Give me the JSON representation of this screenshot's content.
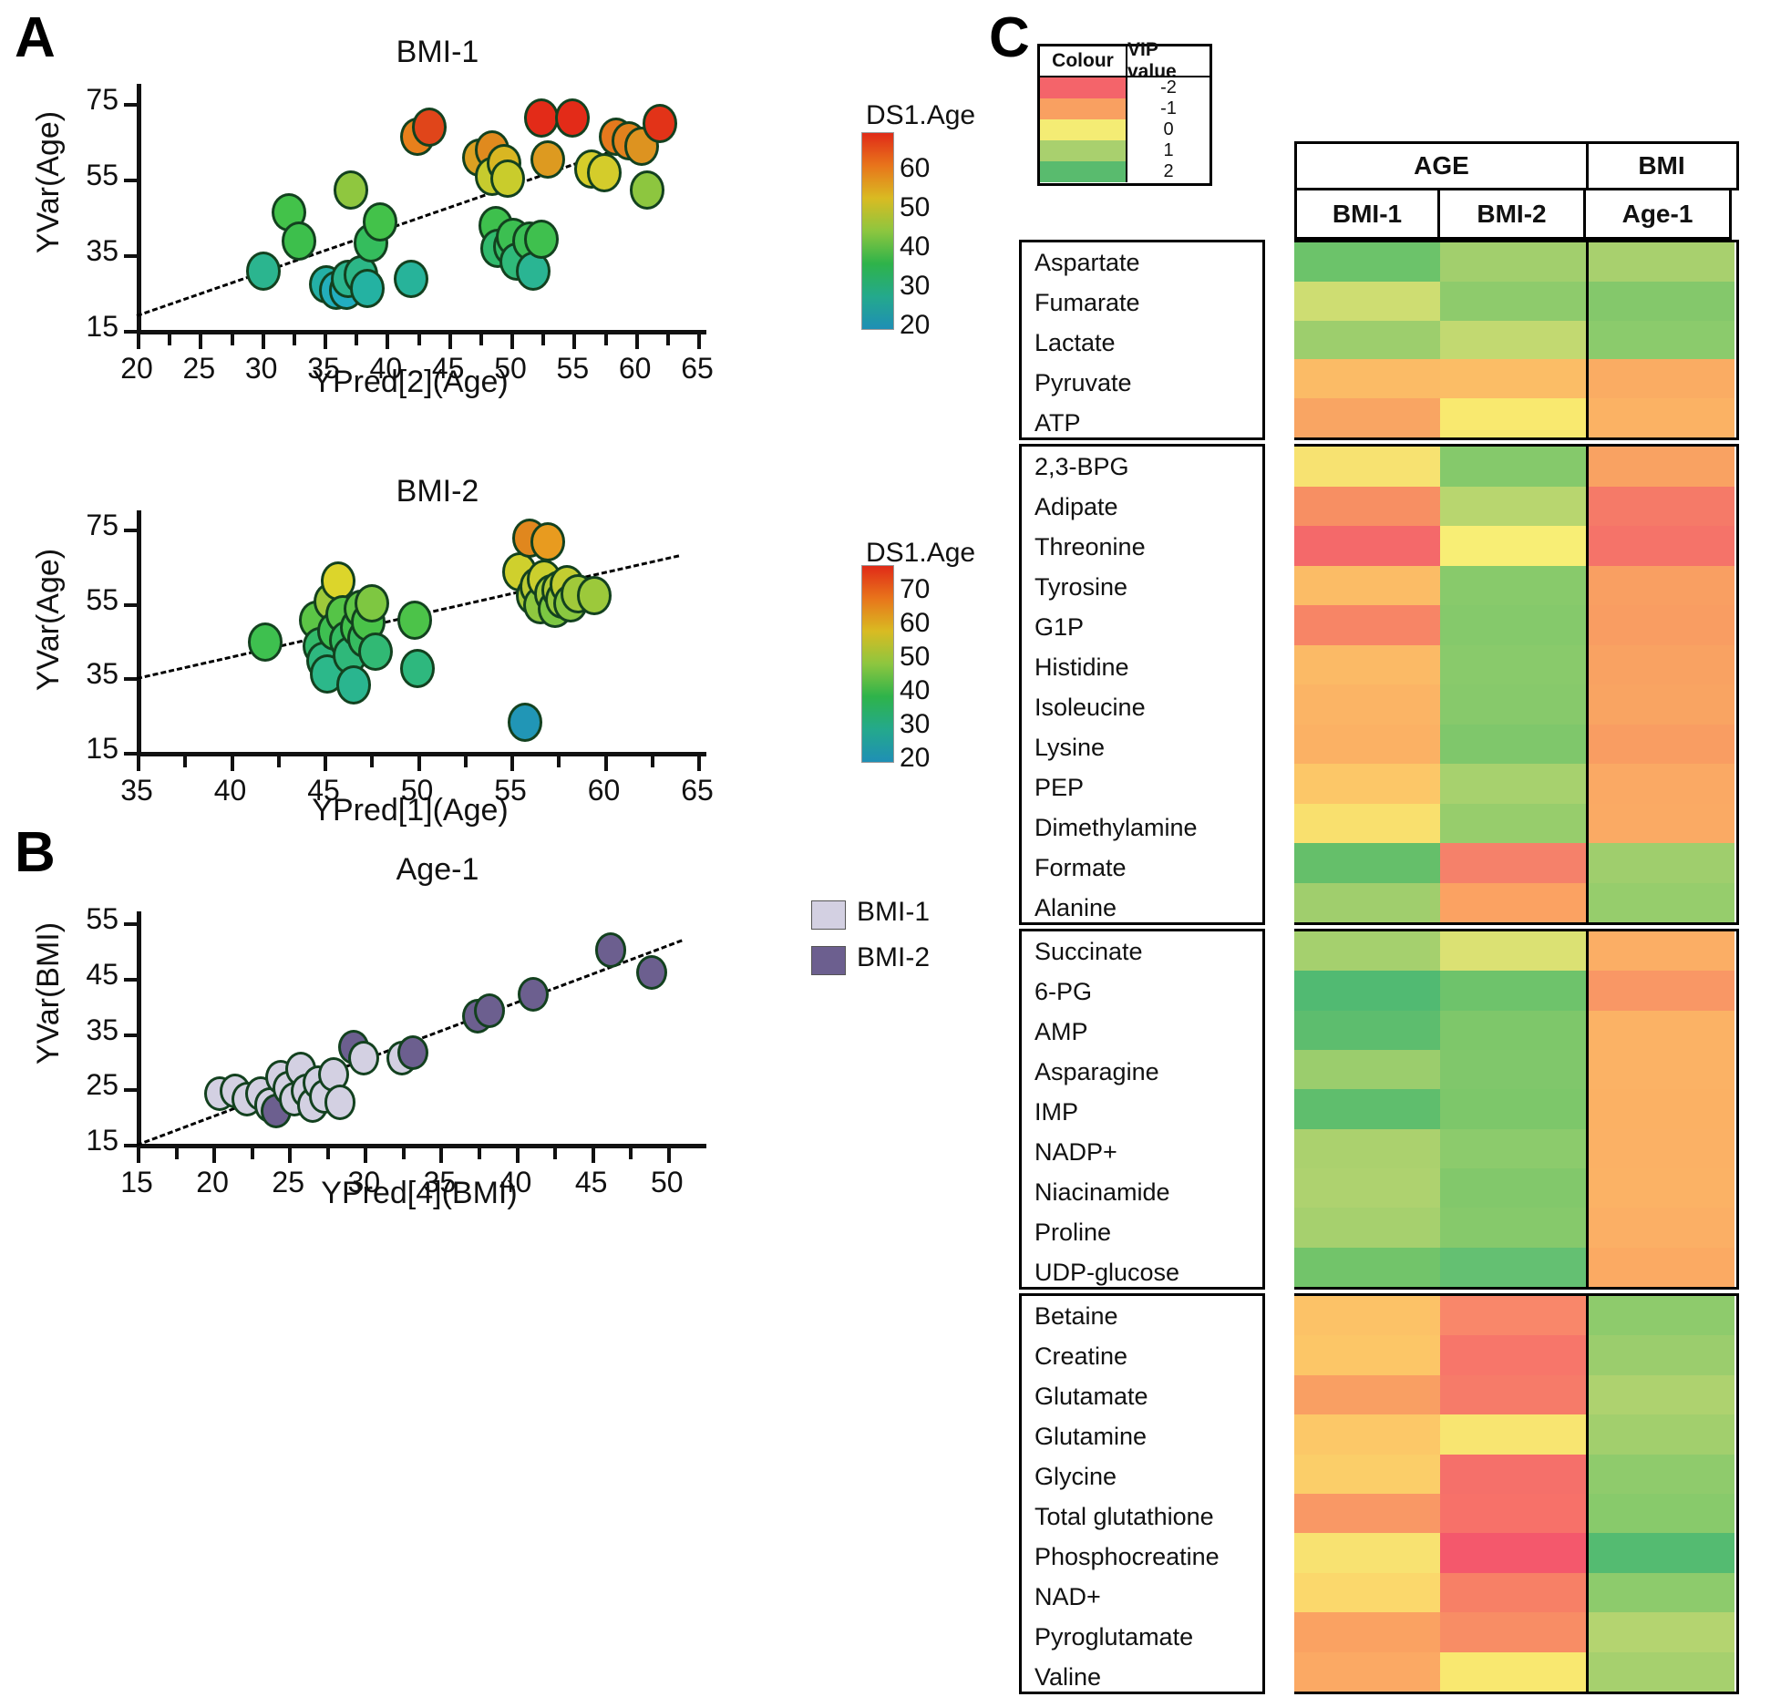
{
  "panels": {
    "a_letter": "A",
    "b_letter": "B",
    "c_letter": "C"
  },
  "chart_data": [
    {
      "type": "scatter",
      "id": "bmi1",
      "title": "BMI-1",
      "xlabel": "YPred[2](Age)",
      "ylabel": "YVar(Age)",
      "xlim": [
        20,
        65
      ],
      "ylim": [
        15,
        80
      ],
      "xticks": [
        20,
        25,
        30,
        35,
        40,
        45,
        50,
        55,
        60,
        65
      ],
      "yticks": [
        15,
        35,
        55,
        75
      ],
      "grid": false,
      "colorbar": {
        "title": "DS1.Age",
        "ticks": [
          60,
          50,
          40,
          30,
          20
        ],
        "min": 20,
        "max": 70,
        "colors": [
          "#e02b18",
          "#e8751b",
          "#d9bb22",
          "#8dc63f",
          "#2eb34a",
          "#24a98c",
          "#1f8fb5"
        ]
      },
      "trendline": {
        "x1": 20,
        "y1": 19,
        "x2": 63,
        "y2": 68
      },
      "points": [
        {
          "x": 30.2,
          "y": 30.5,
          "c": "#2bb58f"
        },
        {
          "x": 32.2,
          "y": 46.0,
          "c": "#43c24a"
        },
        {
          "x": 33.0,
          "y": 38.5,
          "c": "#3dbf4c"
        },
        {
          "x": 35.2,
          "y": 27.0,
          "c": "#24b0a6"
        },
        {
          "x": 36.0,
          "y": 25.5,
          "c": "#23aebb"
        },
        {
          "x": 36.8,
          "y": 25.5,
          "c": "#22aec0"
        },
        {
          "x": 37.0,
          "y": 28.5,
          "c": "#2bb58f"
        },
        {
          "x": 37.2,
          "y": 52.0,
          "c": "#8fc73f"
        },
        {
          "x": 38.0,
          "y": 29.5,
          "c": "#2cb787"
        },
        {
          "x": 38.5,
          "y": 26.0,
          "c": "#24b2a2"
        },
        {
          "x": 38.8,
          "y": 38.0,
          "c": "#35bd5d"
        },
        {
          "x": 39.5,
          "y": 43.5,
          "c": "#43c24a"
        },
        {
          "x": 42.0,
          "y": 28.5,
          "c": "#27b39a"
        },
        {
          "x": 42.5,
          "y": 66.0,
          "c": "#e8801c"
        },
        {
          "x": 43.5,
          "y": 68.5,
          "c": "#e0451a"
        },
        {
          "x": 47.5,
          "y": 60.5,
          "c": "#dba022"
        },
        {
          "x": 48.5,
          "y": 62.5,
          "c": "#e08a1e"
        },
        {
          "x": 48.5,
          "y": 55.5,
          "c": "#c6cb2e"
        },
        {
          "x": 48.8,
          "y": 42.5,
          "c": "#3ec04d"
        },
        {
          "x": 49.0,
          "y": 36.5,
          "c": "#31ba6d"
        },
        {
          "x": 49.5,
          "y": 59.0,
          "c": "#d9b622"
        },
        {
          "x": 49.8,
          "y": 55.0,
          "c": "#c9cc2c"
        },
        {
          "x": 50.0,
          "y": 37.0,
          "c": "#33bb66"
        },
        {
          "x": 50.2,
          "y": 39.5,
          "c": "#3cbf51"
        },
        {
          "x": 50.5,
          "y": 33.0,
          "c": "#2fb97a"
        },
        {
          "x": 51.5,
          "y": 38.5,
          "c": "#3bbf55"
        },
        {
          "x": 51.8,
          "y": 30.5,
          "c": "#2ab593"
        },
        {
          "x": 52.5,
          "y": 39.0,
          "c": "#3fc04e"
        },
        {
          "x": 52.5,
          "y": 71.0,
          "c": "#e32b18"
        },
        {
          "x": 53.0,
          "y": 60.0,
          "c": "#dd9a20"
        },
        {
          "x": 55.0,
          "y": 71.0,
          "c": "#e32b18"
        },
        {
          "x": 56.5,
          "y": 57.5,
          "c": "#d6cd2a"
        },
        {
          "x": 57.5,
          "y": 56.5,
          "c": "#d4cc2b"
        },
        {
          "x": 58.5,
          "y": 66.0,
          "c": "#e5791d"
        },
        {
          "x": 59.5,
          "y": 65.0,
          "c": "#e2811d"
        },
        {
          "x": 60.5,
          "y": 63.5,
          "c": "#dd9320"
        },
        {
          "x": 61.0,
          "y": 52.0,
          "c": "#8dc63f"
        },
        {
          "x": 62.0,
          "y": 69.5,
          "c": "#e23318"
        }
      ]
    },
    {
      "type": "scatter",
      "id": "bmi2",
      "title": "BMI-2",
      "xlabel": "YPred[1](Age)",
      "ylabel": "YVar(Age)",
      "xlim": [
        35,
        65
      ],
      "ylim": [
        15,
        80
      ],
      "xticks": [
        35,
        40,
        45,
        50,
        55,
        60,
        65
      ],
      "yticks": [
        15,
        35,
        55,
        75
      ],
      "grid": false,
      "colorbar": {
        "title": "DS1.Age",
        "ticks": [
          70,
          60,
          50,
          40,
          30,
          20
        ],
        "min": 20,
        "max": 78,
        "colors": [
          "#e02b18",
          "#e8751b",
          "#d9bb22",
          "#8dc63f",
          "#2eb34a",
          "#24a98c",
          "#1f8fb5"
        ]
      },
      "trendline": {
        "x1": 35,
        "y1": 35,
        "x2": 64,
        "y2": 68
      },
      "points": [
        {
          "x": 41.9,
          "y": 44.5,
          "c": "#3ec04f"
        },
        {
          "x": 44.6,
          "y": 50.5,
          "c": "#5cc546"
        },
        {
          "x": 44.8,
          "y": 43.5,
          "c": "#33ba6b"
        },
        {
          "x": 45.0,
          "y": 39.5,
          "c": "#2eb87f"
        },
        {
          "x": 45.2,
          "y": 36.0,
          "c": "#2cb88a"
        },
        {
          "x": 45.4,
          "y": 55.5,
          "c": "#9ec93b"
        },
        {
          "x": 45.6,
          "y": 47.5,
          "c": "#3ec051"
        },
        {
          "x": 45.8,
          "y": 61.0,
          "c": "#dcd52b"
        },
        {
          "x": 46.0,
          "y": 52.0,
          "c": "#55c447"
        },
        {
          "x": 46.2,
          "y": 45.0,
          "c": "#35bc61"
        },
        {
          "x": 46.4,
          "y": 41.0,
          "c": "#2fb87a"
        },
        {
          "x": 46.6,
          "y": 33.0,
          "c": "#2ab58f"
        },
        {
          "x": 46.8,
          "y": 48.5,
          "c": "#43c14c"
        },
        {
          "x": 47.0,
          "y": 53.5,
          "c": "#60c645"
        },
        {
          "x": 47.2,
          "y": 45.5,
          "c": "#36bc60"
        },
        {
          "x": 47.4,
          "y": 50.0,
          "c": "#4ac349"
        },
        {
          "x": 47.6,
          "y": 55.0,
          "c": "#7ec741"
        },
        {
          "x": 47.8,
          "y": 42.0,
          "c": "#31b974"
        },
        {
          "x": 49.9,
          "y": 50.5,
          "c": "#4cc349"
        },
        {
          "x": 50.0,
          "y": 37.5,
          "c": "#2eb87e"
        },
        {
          "x": 55.5,
          "y": 63.5,
          "c": "#cfd02d"
        },
        {
          "x": 55.8,
          "y": 23.0,
          "c": "#2196b6"
        },
        {
          "x": 56.0,
          "y": 72.5,
          "c": "#e0871e"
        },
        {
          "x": 56.2,
          "y": 57.0,
          "c": "#a9ca38"
        },
        {
          "x": 56.4,
          "y": 59.5,
          "c": "#bccb33"
        },
        {
          "x": 56.6,
          "y": 54.5,
          "c": "#8ec83f"
        },
        {
          "x": 56.8,
          "y": 61.5,
          "c": "#cbcf2e"
        },
        {
          "x": 57.0,
          "y": 71.5,
          "c": "#e89b1f"
        },
        {
          "x": 57.2,
          "y": 57.5,
          "c": "#a5ca39"
        },
        {
          "x": 57.4,
          "y": 53.5,
          "c": "#7cc742"
        },
        {
          "x": 57.6,
          "y": 58.5,
          "c": "#b2ca36"
        },
        {
          "x": 57.8,
          "y": 56.0,
          "c": "#98c93c"
        },
        {
          "x": 58.0,
          "y": 60.0,
          "c": "#c3cd31"
        },
        {
          "x": 58.2,
          "y": 55.0,
          "c": "#8ac840"
        },
        {
          "x": 58.6,
          "y": 57.5,
          "c": "#a0c93a"
        },
        {
          "x": 59.5,
          "y": 57.0,
          "c": "#9cc93b"
        }
      ]
    },
    {
      "type": "scatter",
      "id": "age1",
      "title": "Age-1",
      "xlabel": "YPred[4](BMI)",
      "ylabel": "YVar(BMI)",
      "xlim": [
        15,
        52
      ],
      "ylim": [
        15,
        57
      ],
      "xticks": [
        15,
        20,
        25,
        30,
        35,
        40,
        45,
        50
      ],
      "yticks": [
        15,
        25,
        35,
        45,
        55
      ],
      "grid": false,
      "legend": {
        "position": "top-right",
        "entries": [
          {
            "label": "BMI-1",
            "color": "#d3d0e2"
          },
          {
            "label": "BMI-2",
            "color": "#6c5f8f"
          }
        ]
      },
      "trendline": {
        "x1": 15,
        "y1": 15,
        "x2": 51,
        "y2": 52
      },
      "points": [
        {
          "x": 20.5,
          "y": 24.0,
          "c": "#d3d0e2"
        },
        {
          "x": 21.5,
          "y": 24.5,
          "c": "#d3d0e2"
        },
        {
          "x": 22.3,
          "y": 23.0,
          "c": "#d3d0e2"
        },
        {
          "x": 23.2,
          "y": 24.0,
          "c": "#d3d0e2"
        },
        {
          "x": 23.8,
          "y": 22.0,
          "c": "#d3d0e2"
        },
        {
          "x": 24.2,
          "y": 21.0,
          "c": "#6c5f8f"
        },
        {
          "x": 24.5,
          "y": 27.0,
          "c": "#d3d0e2"
        },
        {
          "x": 25.0,
          "y": 25.0,
          "c": "#d3d0e2"
        },
        {
          "x": 25.4,
          "y": 23.0,
          "c": "#d3d0e2"
        },
        {
          "x": 25.8,
          "y": 28.5,
          "c": "#d3d0e2"
        },
        {
          "x": 26.2,
          "y": 24.5,
          "c": "#d3d0e2"
        },
        {
          "x": 26.6,
          "y": 22.0,
          "c": "#d3d0e2"
        },
        {
          "x": 27.0,
          "y": 26.0,
          "c": "#d3d0e2"
        },
        {
          "x": 27.4,
          "y": 23.5,
          "c": "#d3d0e2"
        },
        {
          "x": 28.0,
          "y": 27.5,
          "c": "#d3d0e2"
        },
        {
          "x": 28.4,
          "y": 22.5,
          "c": "#d3d0e2"
        },
        {
          "x": 29.3,
          "y": 32.5,
          "c": "#6c5f8f"
        },
        {
          "x": 30.0,
          "y": 30.5,
          "c": "#d3d0e2"
        },
        {
          "x": 32.5,
          "y": 30.5,
          "c": "#d3d0e2"
        },
        {
          "x": 33.2,
          "y": 31.5,
          "c": "#6c5f8f"
        },
        {
          "x": 37.5,
          "y": 38.0,
          "c": "#6c5f8f"
        },
        {
          "x": 38.3,
          "y": 39.0,
          "c": "#6c5f8f"
        },
        {
          "x": 41.2,
          "y": 42.0,
          "c": "#6c5f8f"
        },
        {
          "x": 46.3,
          "y": 50.0,
          "c": "#6c5f8f"
        },
        {
          "x": 49.0,
          "y": 46.0,
          "c": "#6c5f8f"
        }
      ]
    },
    {
      "type": "heatmap",
      "id": "vip-heatmap",
      "title": "",
      "legend_title_colour": "Colour",
      "legend_title_value": "VIP value",
      "legend_scale": [
        {
          "value": "-2",
          "color": "#f4646a"
        },
        {
          "value": "-1",
          "color": "#f9a061"
        },
        {
          "value": "0",
          "color": "#f4ec74"
        },
        {
          "value": "1",
          "color": "#a9d06e"
        },
        {
          "value": "2",
          "color": "#59bb6e"
        }
      ],
      "group_headers": [
        {
          "label": "AGE",
          "span": 2
        },
        {
          "label": "BMI",
          "span": 1
        }
      ],
      "columns": [
        "BMI-1",
        "BMI-2",
        "Age-1"
      ],
      "blocks": [
        {
          "rows": [
            {
              "label": "Aspartate",
              "values": [
                "#6cc36a",
                "#a2cf6d",
                "#a8d06e"
              ]
            },
            {
              "label": "Fumarate",
              "values": [
                "#cedd72",
                "#8ecb6c",
                "#84c86b"
              ]
            },
            {
              "label": "Lactate",
              "values": [
                "#9dce6d",
                "#c2d971",
                "#8bcb6c"
              ]
            },
            {
              "label": "Pyruvate",
              "values": [
                "#fbbb66",
                "#fbbd66",
                "#faac63"
              ]
            },
            {
              "label": "ATP",
              "values": [
                "#f9a563",
                "#f9e96f",
                "#fbb264"
              ]
            }
          ]
        },
        {
          "rows": [
            {
              "label": "2,3-BPG",
              "values": [
                "#f7e271",
                "#85c96b",
                "#f9a262"
              ]
            },
            {
              "label": "Adipate",
              "values": [
                "#f78f63",
                "#b8d66f",
                "#f57a68"
              ]
            },
            {
              "label": "Threonine",
              "values": [
                "#f4696a",
                "#f8ee75",
                "#f57369"
              ]
            },
            {
              "label": "Tyrosine",
              "values": [
                "#fbbc66",
                "#88ca6b",
                "#f99f62"
              ]
            },
            {
              "label": "G1P",
              "values": [
                "#f78566",
                "#85c96b",
                "#f99d62"
              ]
            },
            {
              "label": "Histidine",
              "values": [
                "#fbba66",
                "#89ca6b",
                "#f9a262"
              ]
            },
            {
              "label": "Isoleucine",
              "values": [
                "#fbb465",
                "#87c96b",
                "#f9a462"
              ]
            },
            {
              "label": "Lysine",
              "values": [
                "#fbb164",
                "#7fc76b",
                "#f99d62"
              ]
            },
            {
              "label": "PEP",
              "values": [
                "#fcc768",
                "#a7d16e",
                "#faa964"
              ]
            },
            {
              "label": "Dimethylamine",
              "values": [
                "#f9e06e",
                "#97cd6c",
                "#faaa64"
              ]
            },
            {
              "label": "Formate",
              "values": [
                "#65bf6a",
                "#f5816a",
                "#9fce6d"
              ]
            },
            {
              "label": "Alanine",
              "values": [
                "#a0ce6d",
                "#fba262",
                "#96cd6c"
              ]
            }
          ]
        },
        {
          "rows": [
            {
              "label": "Succinate",
              "values": [
                "#a5d06e",
                "#dbe173",
                "#fbae65"
              ]
            },
            {
              "label": "6-PG",
              "values": [
                "#51ba72",
                "#6ec36b",
                "#f99765"
              ]
            },
            {
              "label": "AMP",
              "values": [
                "#5dbd6e",
                "#7ec76a",
                "#fbb265"
              ]
            },
            {
              "label": "Asparagine",
              "values": [
                "#9bcd6d",
                "#80c76b",
                "#fbb265"
              ]
            },
            {
              "label": "IMP",
              "values": [
                "#5fbe6d",
                "#7dc76a",
                "#fbb164"
              ]
            },
            {
              "label": "NADP+",
              "values": [
                "#abd16e",
                "#8ccb6c",
                "#fbb165"
              ]
            },
            {
              "label": "Niacinamide",
              "values": [
                "#aed26f",
                "#82c86b",
                "#fbb265"
              ]
            },
            {
              "label": "Proline",
              "values": [
                "#a6d06e",
                "#86c96b",
                "#fbaf65"
              ]
            },
            {
              "label": "UDP-glucose",
              "values": [
                "#72c46a",
                "#64c072",
                "#fbaa63"
              ]
            }
          ]
        },
        {
          "rows": [
            {
              "label": "Betaine",
              "values": [
                "#fcc267",
                "#f9876a",
                "#8ecb6c"
              ]
            },
            {
              "label": "Creatine",
              "values": [
                "#fcc667",
                "#f7766a",
                "#9bcd6d"
              ]
            },
            {
              "label": "Glutamate",
              "values": [
                "#f99f63",
                "#f67b69",
                "#aed26f"
              ]
            },
            {
              "label": "Glutamine",
              "values": [
                "#fcc868",
                "#f8e571",
                "#a2cf6d"
              ]
            },
            {
              "label": "Glycine",
              "values": [
                "#fbce69",
                "#f5706a",
                "#8fcb6c"
              ]
            },
            {
              "label": "Total glutathione",
              "values": [
                "#f99865",
                "#f77169",
                "#88ca6b"
              ]
            },
            {
              "label": "Phosphocreatine",
              "values": [
                "#f8e271",
                "#f4586c",
                "#54bb71"
              ]
            },
            {
              "label": "NAD+",
              "values": [
                "#fbd86c",
                "#f78066",
                "#8dcb6c"
              ]
            },
            {
              "label": "Pyroglutamate",
              "values": [
                "#faa262",
                "#f88d65",
                "#b4d470"
              ]
            },
            {
              "label": "Valine",
              "values": [
                "#fba964",
                "#f9e870",
                "#a6d06e"
              ]
            }
          ]
        }
      ]
    }
  ]
}
